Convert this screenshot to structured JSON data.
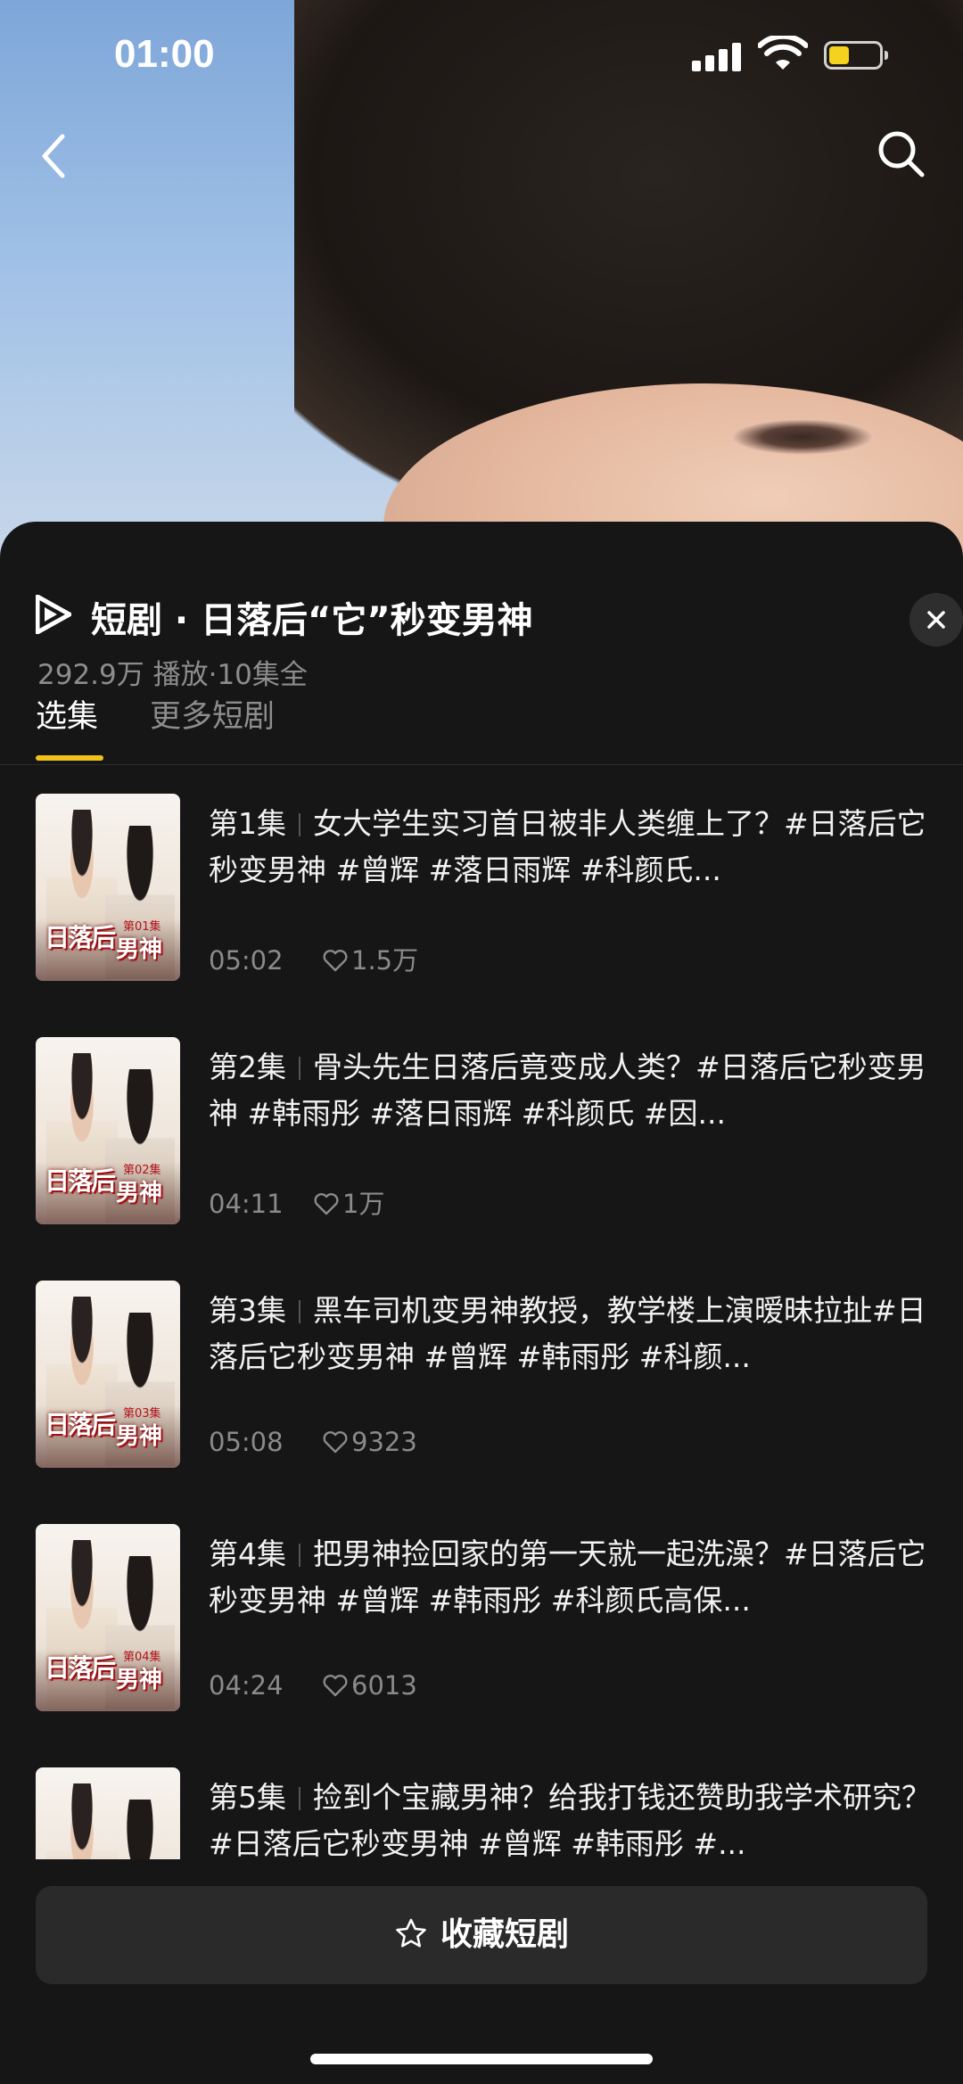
{
  "status_bar": {
    "time": "01:00"
  },
  "sheet": {
    "title": "短剧 · 日落后“它”秒变男神",
    "meta": "292.9万 播放·10集全",
    "tabs": [
      {
        "label": "选集",
        "active": true
      },
      {
        "label": "更多短剧",
        "active": false
      }
    ]
  },
  "episodes": [
    {
      "label": "第1集",
      "title": "女大学生实习首日被非人类缠上了？#日落后它秒变男神 #曾辉 #落日雨辉 #科颜氏...",
      "duration": "05:02",
      "likes": "1.5万",
      "thumb_logo": "日落后",
      "thumb_logo2": "男神",
      "thumb_tag": "第01集"
    },
    {
      "label": "第2集",
      "title": "骨头先生日落后竟变成人类？#日落后它秒变男神 #韩雨彤 #落日雨辉 #科颜氏 #因...",
      "duration": "04:11",
      "likes": "1万",
      "thumb_logo": "日落后",
      "thumb_logo2": "男神",
      "thumb_tag": "第02集"
    },
    {
      "label": "第3集",
      "title": "黑车司机变男神教授，教学楼上演暧昧拉扯#日落后它秒变男神 #曾辉 #韩雨彤 #科颜...",
      "duration": "05:08",
      "likes": "9323",
      "thumb_logo": "日落后",
      "thumb_logo2": "男神",
      "thumb_tag": "第03集"
    },
    {
      "label": "第4集",
      "title": "把男神捡回家的第一天就一起洗澡？#日落后它秒变男神 #曾辉 #韩雨彤 #科颜氏高保...",
      "duration": "04:24",
      "likes": "6013",
      "thumb_logo": "日落后",
      "thumb_logo2": "男神",
      "thumb_tag": "第04集"
    },
    {
      "label": "第5集",
      "title": "捡到个宝藏男神？给我打钱还赞助我学术研究？#日落后它秒变男神 #曾辉 #韩雨彤 #...",
      "duration": "",
      "likes": "",
      "thumb_logo": "",
      "thumb_logo2": "",
      "thumb_tag": ""
    }
  ],
  "bottom": {
    "collect_label": "收藏短剧"
  },
  "icons": {
    "back": "chevron-left-icon",
    "search": "search-icon",
    "close": "close-icon",
    "brand": "play-brand-icon",
    "heart": "heart-icon",
    "star": "star-icon"
  },
  "colors": {
    "accent": "#f2c21b",
    "background": "#161616",
    "button": "#2a2a2a"
  }
}
